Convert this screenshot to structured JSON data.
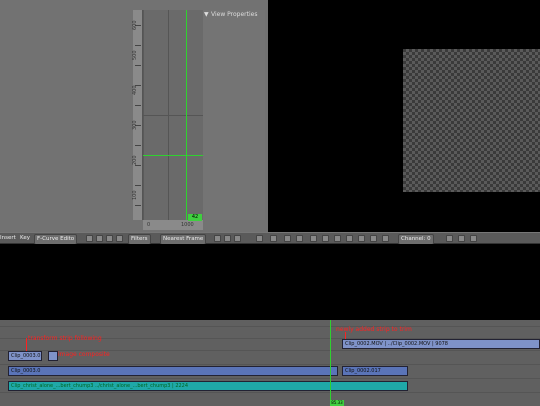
{
  "graph": {
    "ruler_labels": [
      "600",
      "500",
      "400",
      "300",
      "200",
      "100"
    ],
    "frame_marker": "42",
    "bottom_ruler_labels": [
      "0",
      "1000"
    ],
    "properties_label": "View Properties"
  },
  "header": {
    "left_cut": "Insert",
    "key_menu": "Key",
    "editor_type": "F-Curve Edito",
    "filters_label": "Filters",
    "interpolation": "Nearest Frame",
    "channel_label": "Channel: 0"
  },
  "sequencer": {
    "strips": {
      "clip_0003": "Clip_0003.0",
      "clip_0003_short": "Clip_0003.0",
      "clip_0002_top": "Clip_0002.MOV | ../Clip_0002.MOV | 9078",
      "clip_0002_left": "Clip_0002.017",
      "cyan_long": "Clip_christ_alone_...bert_chump3 ../christ_alone_...bert_chump3 | 2224"
    },
    "annotations": {
      "ann_left_top": "transform strip following",
      "ann_left_mid": "image composite",
      "ann_right_top": "newly added strip to trim"
    },
    "frame_marker": "85.33"
  },
  "colors": {
    "playhead": "#2fd12f",
    "annotation": "#ff2020",
    "strip_blue": "#5a74b8",
    "strip_cyan": "#1fa8a8"
  }
}
